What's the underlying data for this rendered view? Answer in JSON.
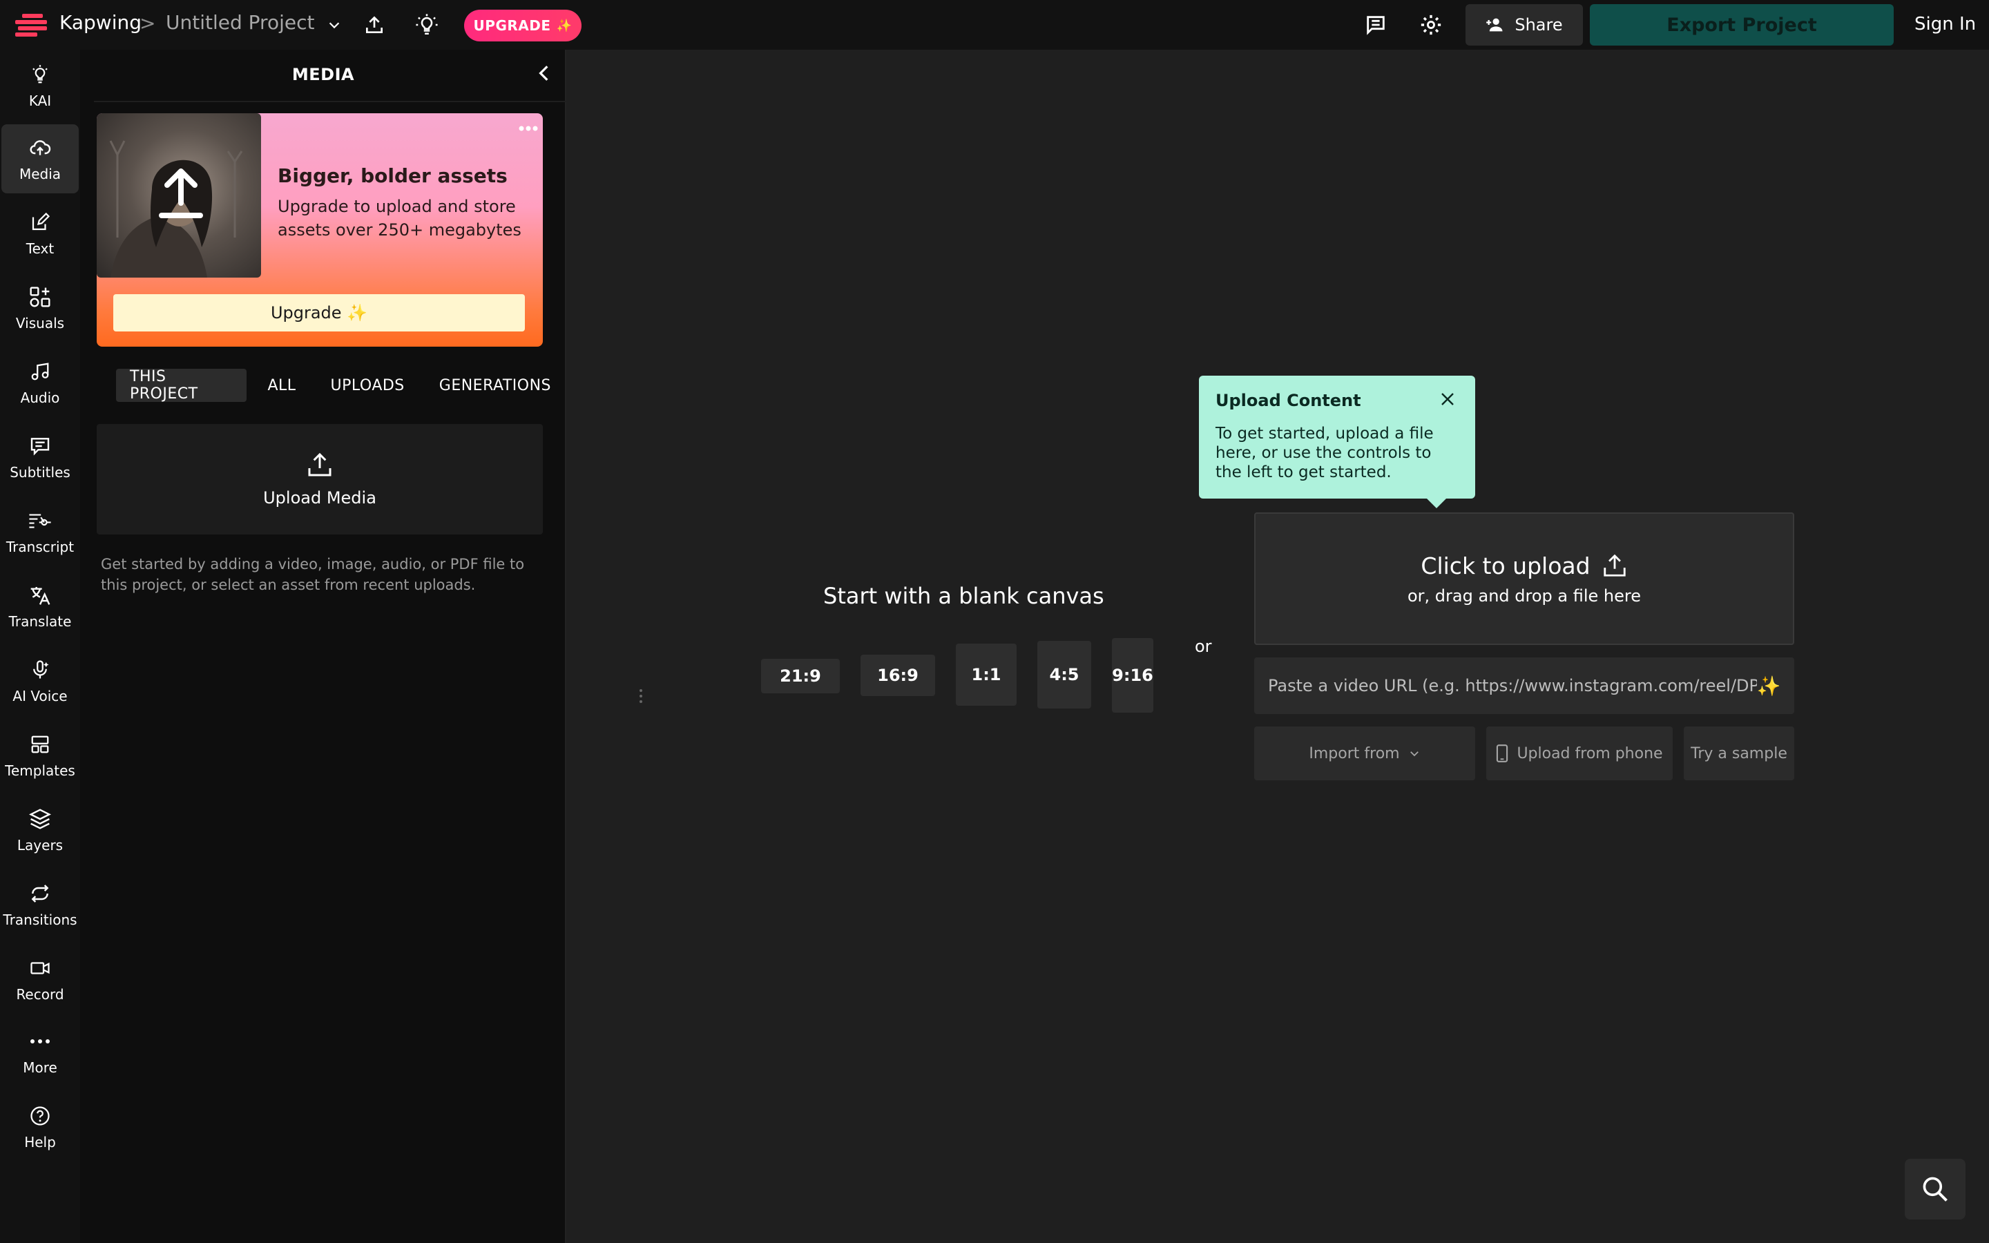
{
  "topbar": {
    "brand": "Kapwing",
    "separator": ">",
    "project_title": "Untitled Project",
    "upgrade_label": "UPGRADE",
    "share_label": "Share",
    "export_label": "Export Project",
    "signin_label": "Sign In",
    "colors": {
      "upgrade": "#ff2a7d",
      "export": "#0f4f4a"
    }
  },
  "rail": {
    "items": [
      {
        "label": "KAI",
        "icon": "lightbulb-icon"
      },
      {
        "label": "Media",
        "icon": "upload-cloud-icon"
      },
      {
        "label": "Text",
        "icon": "edit-icon"
      },
      {
        "label": "Visuals",
        "icon": "shapes-icon"
      },
      {
        "label": "Audio",
        "icon": "music-note-icon"
      },
      {
        "label": "Subtitles",
        "icon": "subtitles-icon"
      },
      {
        "label": "Transcript",
        "icon": "transcript-icon"
      },
      {
        "label": "Translate",
        "icon": "translate-icon"
      },
      {
        "label": "AI Voice",
        "icon": "microphone-icon"
      },
      {
        "label": "Templates",
        "icon": "templates-icon"
      },
      {
        "label": "Layers",
        "icon": "layers-icon"
      },
      {
        "label": "Transitions",
        "icon": "transitions-icon"
      },
      {
        "label": "Record",
        "icon": "video-camera-icon"
      },
      {
        "label": "More",
        "icon": "more-dots-icon"
      },
      {
        "label": "Help",
        "icon": "help-circle-icon"
      }
    ],
    "active": "Media"
  },
  "panel": {
    "title": "MEDIA",
    "promo": {
      "heading": "Bigger, bolder assets",
      "body": "Upgrade to upload and store assets over 250+ megabytes",
      "button": "Upgrade ✨"
    },
    "tabs": [
      "THIS PROJECT",
      "ALL",
      "UPLOADS",
      "GENERATIONS"
    ],
    "active_tab": "THIS PROJECT",
    "upload_label": "Upload Media",
    "help_text": "Get started by adding a video, image, audio, or PDF file to this project, or select an asset from recent uploads."
  },
  "canvas": {
    "blank_title": "Start with a blank canvas",
    "ratios": [
      "21:9",
      "16:9",
      "1:1",
      "4:5",
      "9:16"
    ],
    "or_label": "or",
    "tooltip": {
      "title": "Upload Content",
      "body": "To get started, upload a file here, or use the controls to the left to get started."
    },
    "dropzone": {
      "main": "Click to upload",
      "sub": "or, drag and drop a file here"
    },
    "url_placeholder": "Paste a video URL (e.g. https://www.instagram.com/reel/DPDUI",
    "import_label": "Import from",
    "phone_label": "Upload from phone",
    "sample_label": "Try a sample",
    "tooltip_color": "#aef2dc"
  }
}
